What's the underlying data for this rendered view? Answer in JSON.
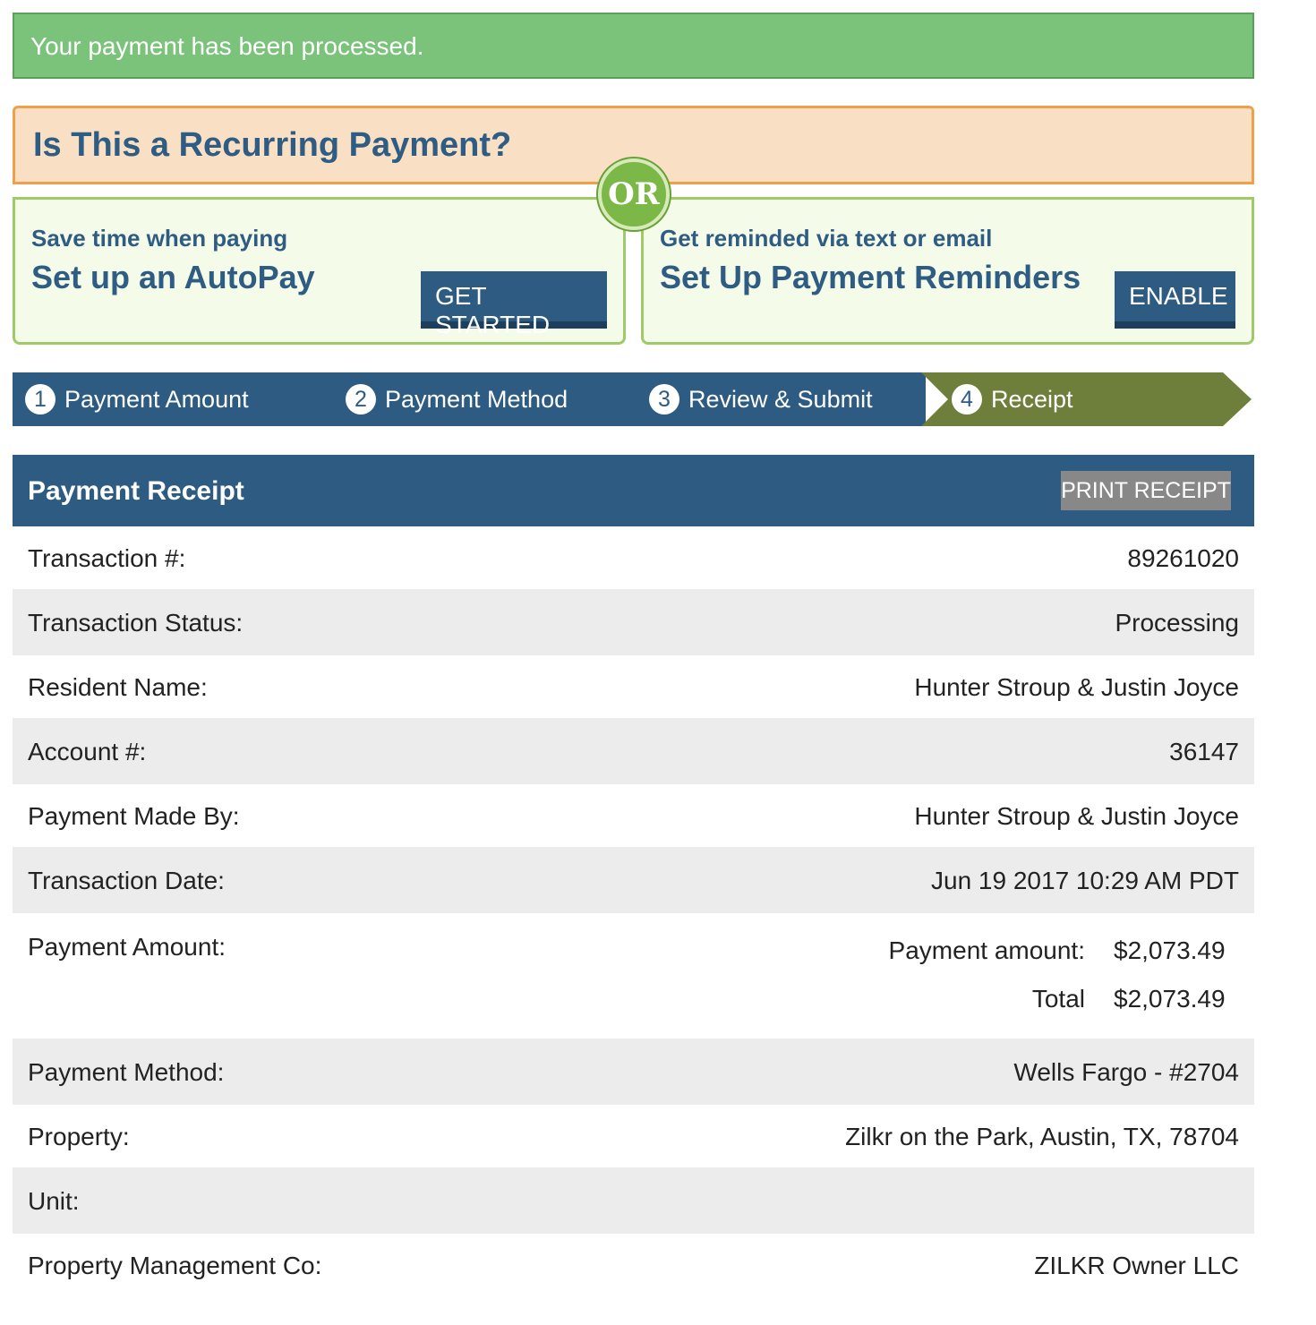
{
  "alert": {
    "message": "Your payment has been processed."
  },
  "recurring": {
    "heading": "Is This a Recurring Payment?",
    "or_label": "OR",
    "autopay": {
      "subtitle": "Save time when paying",
      "title": "Set up an AutoPay",
      "button": "GET STARTED"
    },
    "reminders": {
      "subtitle": "Get reminded via text or email",
      "title": "Set Up Payment Reminders",
      "button": "ENABLE"
    }
  },
  "steps": [
    {
      "num": "1",
      "label": "Payment Amount",
      "active": false
    },
    {
      "num": "2",
      "label": "Payment Method",
      "active": false
    },
    {
      "num": "3",
      "label": "Review & Submit",
      "active": false
    },
    {
      "num": "4",
      "label": "Receipt",
      "active": true
    }
  ],
  "receipt": {
    "title": "Payment Receipt",
    "print_button": "PRINT RECEIPT",
    "rows": {
      "transaction_number": {
        "label": "Transaction #:",
        "value": "89261020"
      },
      "transaction_status": {
        "label": "Transaction Status:",
        "value": "Processing"
      },
      "resident_name": {
        "label": "Resident Name:",
        "value": "Hunter Stroup & Justin Joyce"
      },
      "account_number": {
        "label": "Account #:",
        "value": "36147"
      },
      "payment_made_by": {
        "label": "Payment Made By:",
        "value": "Hunter Stroup & Justin Joyce"
      },
      "transaction_date": {
        "label": "Transaction Date:",
        "value": "Jun 19 2017 10:29 AM PDT"
      },
      "payment_amount": {
        "label": "Payment Amount:",
        "lines": [
          {
            "label": "Payment amount:",
            "value": "$2,073.49"
          },
          {
            "label": "Total",
            "value": "$2,073.49"
          }
        ]
      },
      "payment_method": {
        "label": "Payment Method:",
        "value": "Wells Fargo - #2704"
      },
      "property": {
        "label": "Property:",
        "value": "Zilkr on the Park, Austin, TX, 78704"
      },
      "unit": {
        "label": "Unit:",
        "value": ""
      },
      "management_co": {
        "label": "Property Management Co:",
        "value": "ZILKR Owner LLC"
      }
    }
  },
  "colors": {
    "success": "#7bc27b",
    "primary": "#2d5b82",
    "active_step": "#6d7f3a",
    "recurring_bg": "#f9e0c4",
    "recurring_border": "#f0a04a",
    "option_border": "#9ecb68"
  }
}
